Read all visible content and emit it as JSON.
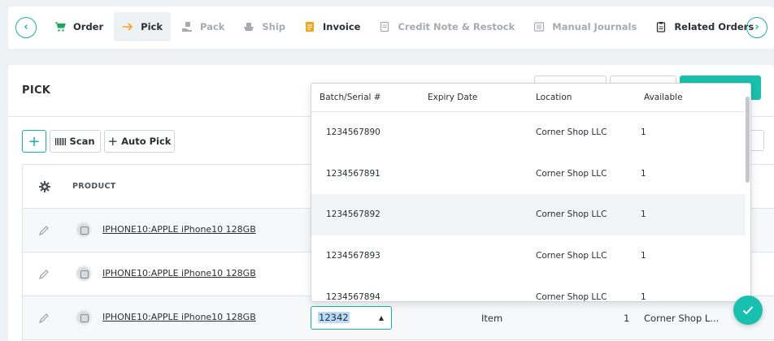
{
  "nav": {
    "prev_icon": "chevron-left-icon",
    "next_icon": "chevron-right-icon",
    "tabs": [
      {
        "label": "Order",
        "icon": "cart-icon",
        "state": "normal"
      },
      {
        "label": "Pick",
        "icon": "arrow-right-icon",
        "state": "active"
      },
      {
        "label": "Pack",
        "icon": "box-hand-icon",
        "state": "disabled"
      },
      {
        "label": "Ship",
        "icon": "ship-icon",
        "state": "disabled"
      },
      {
        "label": "Invoice",
        "icon": "invoice-icon",
        "state": "normal"
      },
      {
        "label": "Credit Note & Restock",
        "icon": "credit-note-icon",
        "state": "disabled"
      },
      {
        "label": "Manual Journals",
        "icon": "journal-icon",
        "state": "disabled"
      },
      {
        "label": "Related Orders",
        "icon": "clipboard-icon",
        "state": "normal"
      }
    ]
  },
  "pick": {
    "title": "PICK",
    "scan_label": "Scan",
    "auto_pick_label": "Auto Pick",
    "table": {
      "product_header": "PRODUCT",
      "rows": [
        {
          "product": "IPHONE10:APPLE iPhone10 128GB"
        },
        {
          "product": "IPHONE10:APPLE iPhone10 128GB"
        },
        {
          "product": "IPHONE10:APPLE iPhone10 128GB",
          "batch_value": "12342",
          "uom": "Item",
          "quantity": "1",
          "location": "Corner Shop L..."
        }
      ]
    }
  },
  "batch_dropdown": {
    "headers": [
      "Batch/Serial #",
      "Expiry Date",
      "Location",
      "Available"
    ],
    "rows": [
      {
        "batch": "1234567890",
        "expiry": "",
        "location": "Corner Shop LLC",
        "available": "1"
      },
      {
        "batch": "1234567891",
        "expiry": "",
        "location": "Corner Shop LLC",
        "available": "1"
      },
      {
        "batch": "1234567892",
        "expiry": "",
        "location": "Corner Shop LLC",
        "available": "1"
      },
      {
        "batch": "1234567893",
        "expiry": "",
        "location": "Corner Shop LLC",
        "available": "1"
      },
      {
        "batch": "1234567894",
        "expiry": "",
        "location": "Corner Shop LLC",
        "available": "1"
      }
    ]
  },
  "colors": {
    "accent": "#17c1ad",
    "disabled_text": "#a7abb0",
    "invoice_icon": "#f2a51a",
    "cart_icon": "#1aa85a"
  }
}
